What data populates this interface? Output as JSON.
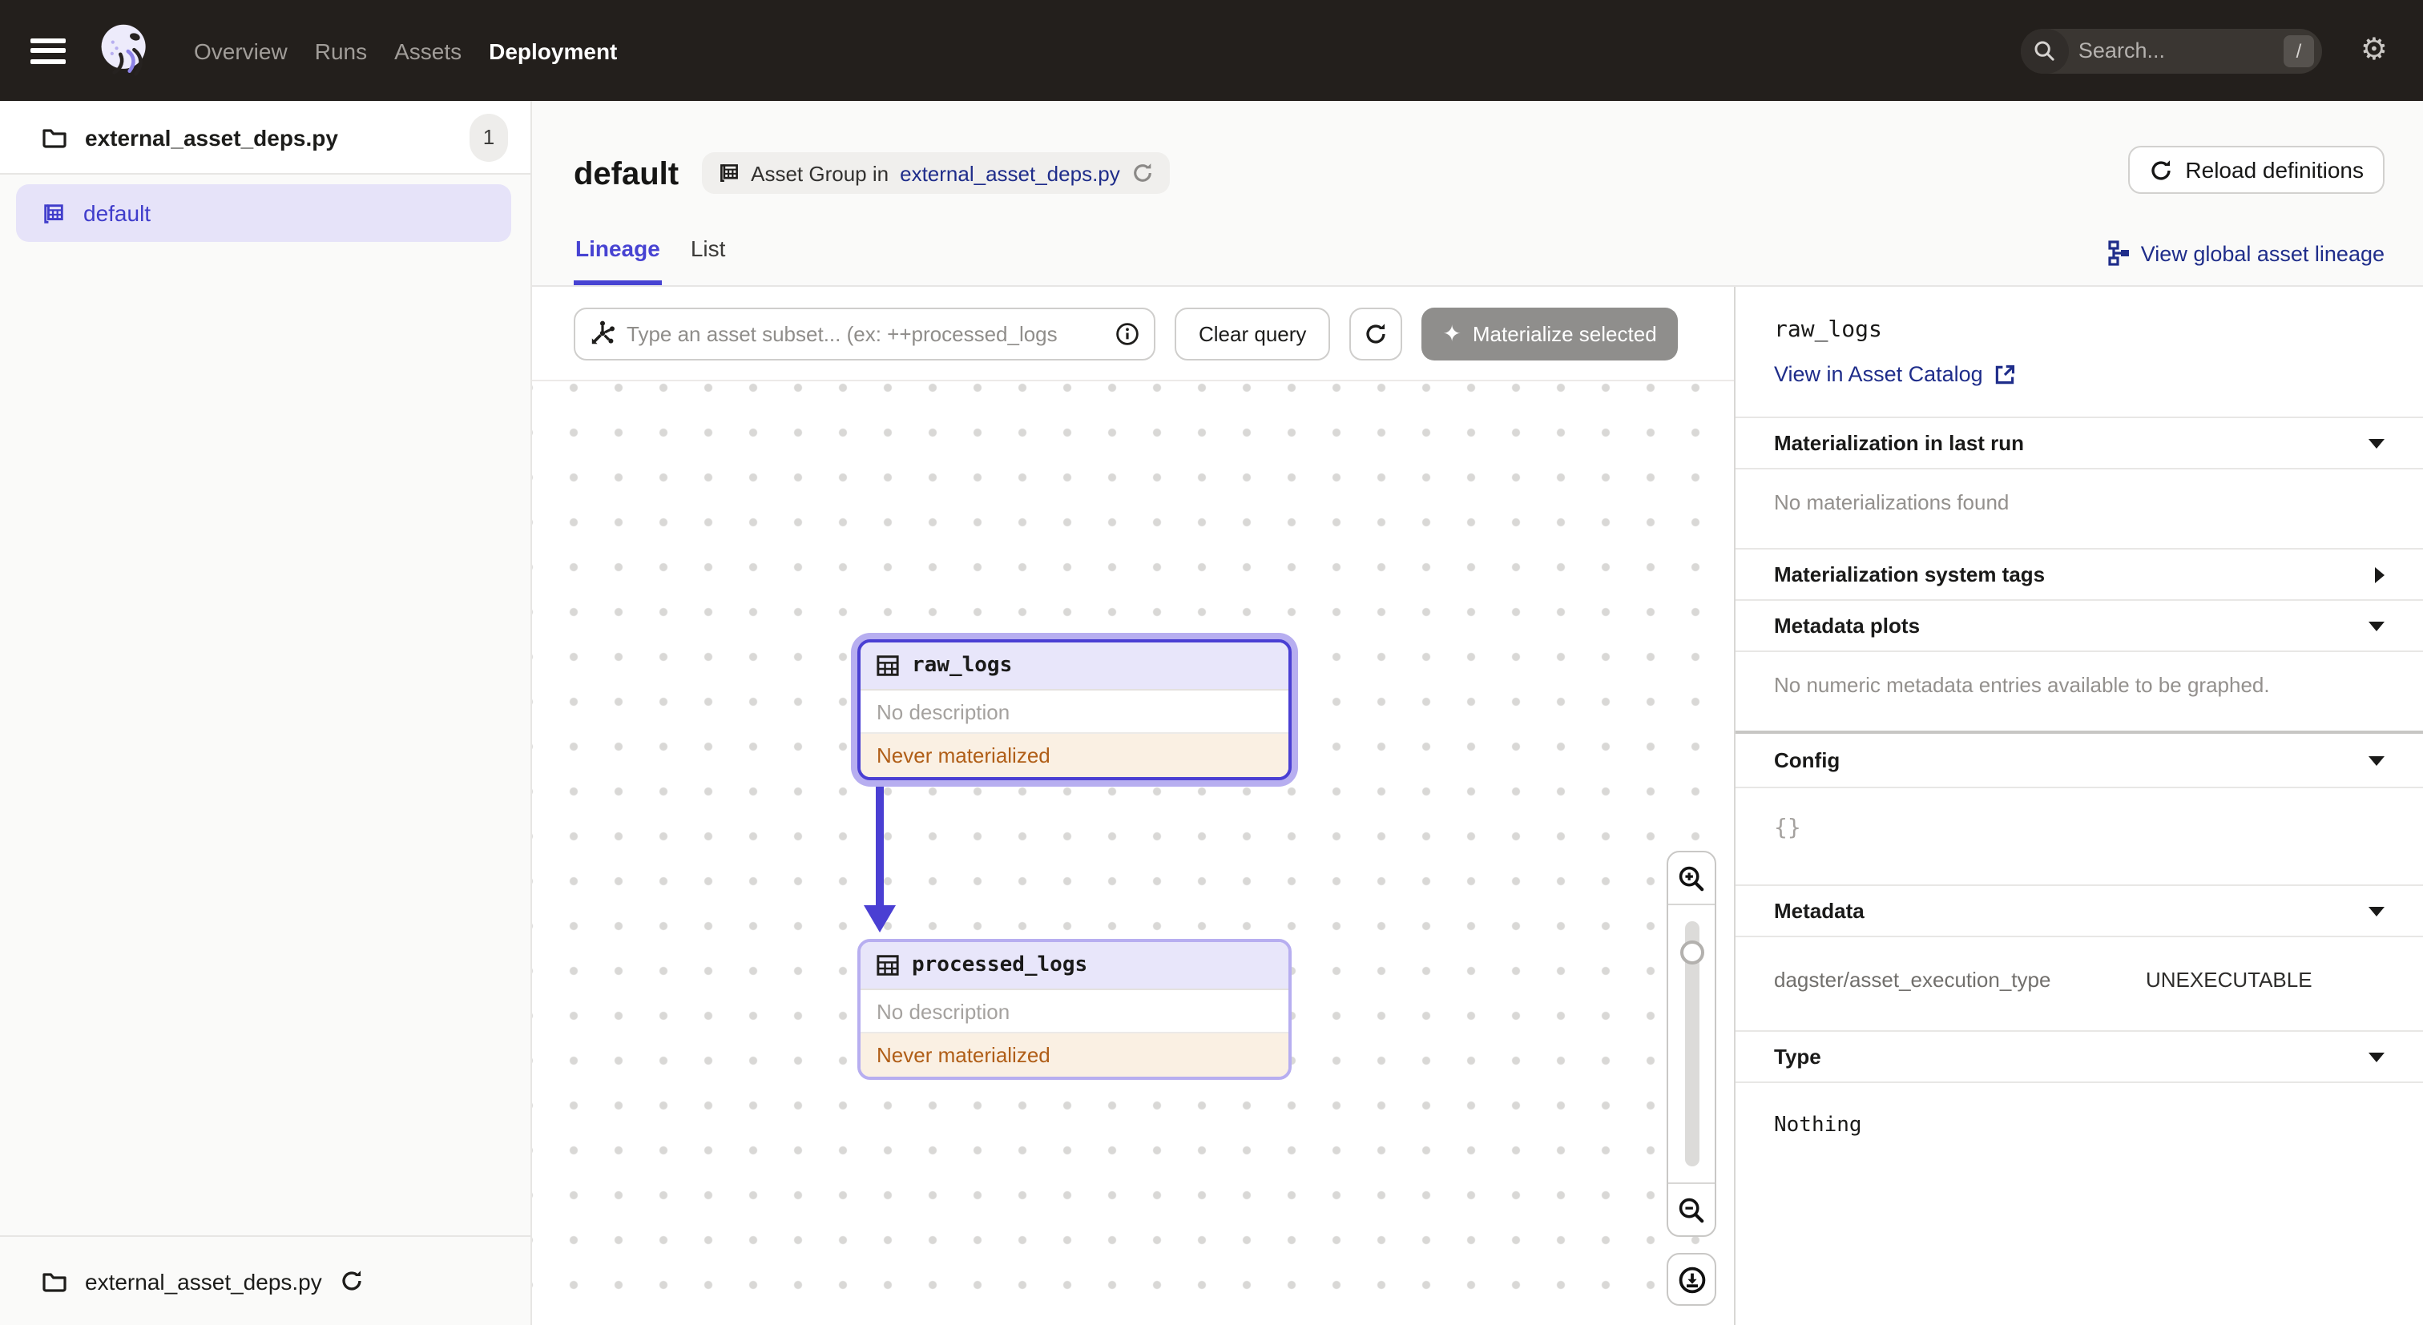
{
  "topbar": {
    "nav": [
      {
        "label": "Overview"
      },
      {
        "label": "Runs"
      },
      {
        "label": "Assets"
      },
      {
        "label": "Deployment",
        "active": true
      }
    ],
    "search_placeholder": "Search...",
    "search_shortcut": "/"
  },
  "sidebar": {
    "repo": {
      "name": "external_asset_deps.py",
      "badge": "1"
    },
    "groups": [
      {
        "label": "default",
        "selected": true
      }
    ],
    "footer": {
      "name": "external_asset_deps.py"
    }
  },
  "header": {
    "title": "default",
    "context_prefix": "Asset Group in",
    "context_link": "external_asset_deps.py",
    "reload_label": "Reload definitions"
  },
  "tabs": {
    "items": [
      {
        "label": "Lineage",
        "active": true
      },
      {
        "label": "List",
        "active": false
      }
    ],
    "global_lineage_label": "View global asset lineage"
  },
  "toolbar": {
    "query_placeholder": "Type an asset subset... (ex: ++processed_logs",
    "clear_label": "Clear query",
    "materialize_label": "Materialize selected",
    "sparkle_glyph": "✦"
  },
  "graph": {
    "nodes": [
      {
        "label": "raw_logs",
        "description": "No description",
        "status": "Never materialized",
        "selected": true
      },
      {
        "label": "processed_logs",
        "description": "No description",
        "status": "Never materialized",
        "selected": false
      }
    ],
    "edges": [
      {
        "from": "raw_logs",
        "to": "processed_logs"
      }
    ]
  },
  "panel": {
    "title": "raw_logs",
    "catalog_link": "View in Asset Catalog",
    "sections": [
      {
        "title": "Materialization in last run",
        "body": "No materializations found"
      },
      {
        "title": "Materialization system tags"
      },
      {
        "title": "Metadata plots",
        "body": "No numeric metadata entries available to be graphed."
      },
      {
        "title": "Config",
        "body": "{}"
      },
      {
        "title": "Metadata",
        "key": "dagster/asset_execution_type",
        "value": "UNEXECUTABLE"
      },
      {
        "title": "Type",
        "body": "Nothing"
      }
    ]
  },
  "colors": {
    "topbar_bg": "#231f1c",
    "accent_indigo": "#4a3fd3",
    "lavender": "#b7aef0",
    "link_navy": "#1f2d8a",
    "status_orange": "#b05e17",
    "status_bg": "#faf0e3",
    "sidebar_bg": "#fafaf9"
  }
}
